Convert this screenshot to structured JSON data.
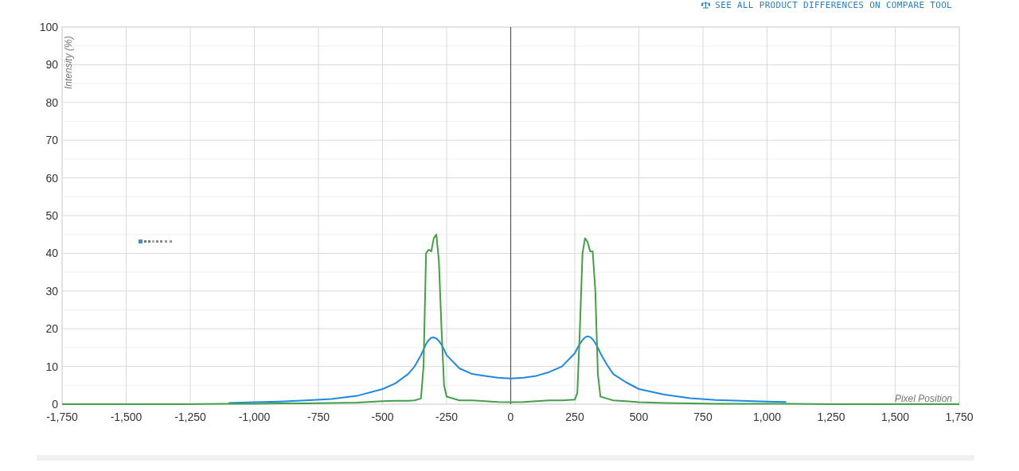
{
  "compare_link": {
    "label": "SEE ALL PRODUCT DIFFERENCES ON COMPARE TOOL"
  },
  "chart": {
    "chart_data": {
      "type": "line",
      "xlabel": "Pixel Position",
      "ylabel": "Intensity (%)",
      "grid": true,
      "xlim": [
        -1750,
        1750
      ],
      "ylim": [
        0,
        100
      ],
      "xticks": [
        {
          "value": -1750,
          "label": "-1,750"
        },
        {
          "value": -1500,
          "label": "-1,500"
        },
        {
          "value": -1250,
          "label": "-1,250"
        },
        {
          "value": -1000,
          "label": "-1,000"
        },
        {
          "value": -750,
          "label": "-750"
        },
        {
          "value": -500,
          "label": "-500"
        },
        {
          "value": -250,
          "label": "-250"
        },
        {
          "value": 0,
          "label": "0"
        },
        {
          "value": 250,
          "label": "250"
        },
        {
          "value": 500,
          "label": "500"
        },
        {
          "value": 750,
          "label": "750"
        },
        {
          "value": 1000,
          "label": "1,000"
        },
        {
          "value": 1250,
          "label": "1,250"
        },
        {
          "value": 1500,
          "label": "1,500"
        },
        {
          "value": 1750,
          "label": "1,750"
        }
      ],
      "yticks": [
        0,
        10,
        20,
        30,
        40,
        50,
        60,
        70,
        80,
        90,
        100
      ],
      "x": [
        -1750,
        -1500,
        -1250,
        -1100,
        -1000,
        -900,
        -800,
        -700,
        -600,
        -500,
        -450,
        -400,
        -375,
        -350,
        -340,
        -330,
        -320,
        -310,
        -300,
        -290,
        -280,
        -270,
        -260,
        -250,
        -200,
        -150,
        -100,
        -50,
        0,
        50,
        100,
        150,
        200,
        250,
        260,
        270,
        280,
        290,
        300,
        310,
        320,
        330,
        340,
        350,
        375,
        400,
        450,
        500,
        600,
        700,
        800,
        900,
        1000,
        1075,
        1250,
        1500,
        1750
      ],
      "series": [
        {
          "color": "#1e88e5",
          "values": [
            null,
            null,
            null,
            0.3,
            0.5,
            0.7,
            1,
            1.4,
            2.2,
            4,
            5.5,
            8,
            10,
            13,
            14.5,
            16,
            17,
            17.6,
            17.7,
            17.4,
            16.8,
            15.8,
            14.5,
            13,
            9.5,
            8,
            7.5,
            7,
            6.8,
            7,
            7.5,
            8.5,
            10,
            13.5,
            14.8,
            16,
            17,
            17.7,
            18,
            17.8,
            17.2,
            16.2,
            15,
            13.5,
            10.5,
            8,
            5.8,
            4,
            2.5,
            1.6,
            1.1,
            0.9,
            0.7,
            0.6,
            null,
            null,
            null
          ]
        },
        {
          "color": "#43a047",
          "values": [
            0,
            0,
            0,
            0.1,
            0.1,
            0.2,
            0.2,
            0.3,
            0.4,
            0.8,
            0.9,
            0.9,
            1,
            1.5,
            10,
            40,
            41,
            40.5,
            44,
            45,
            38,
            20,
            5,
            2,
            1,
            1,
            0.8,
            0.6,
            0.5,
            0.6,
            0.8,
            1,
            1,
            1.2,
            3,
            20,
            40,
            44,
            43,
            40.5,
            40.5,
            30,
            8,
            2,
            1.5,
            1,
            0.8,
            0.5,
            0.3,
            0.2,
            0.1,
            0.1,
            0.1,
            0.1,
            0,
            0,
            0
          ]
        }
      ]
    }
  }
}
